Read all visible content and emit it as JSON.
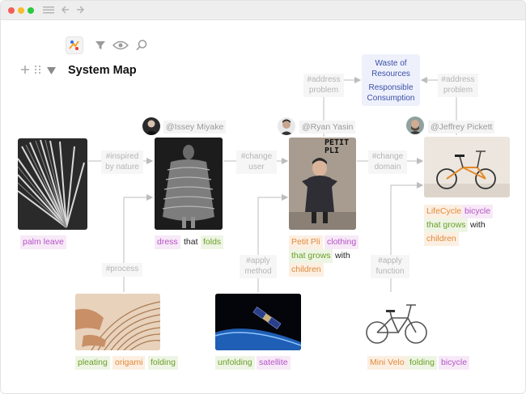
{
  "window": {
    "colors": {
      "close": "#f25f57",
      "minimize": "#f7bc2e",
      "maximize": "#2ac940"
    },
    "icons": [
      "menu-icon",
      "back-arrow-icon",
      "forward-arrow-icon"
    ]
  },
  "toolbar": {
    "icons": [
      "app-logo-icon",
      "filter-icon",
      "eye-icon",
      "search-icon"
    ]
  },
  "header": {
    "title": "System Map",
    "icons": [
      "plus-icon",
      "drag-handle-icon",
      "collapse-triangle-icon"
    ]
  },
  "relations": {
    "inspired": "#inspired\nby nature",
    "change_user": "#change\nuser",
    "change_domain": "#change\ndomain",
    "process": "#process",
    "apply_method": "#apply\nmethod",
    "apply_function": "#apply\nfunction",
    "address_left": "#address\nproblem",
    "address_right": "#address\nproblem"
  },
  "concepts": {
    "waste": "Waste of\nResources",
    "responsible": "Responsible\nConsumption"
  },
  "users": {
    "issey": "@Issey Miyake",
    "ryan": "@Ryan Yasin",
    "jeffrey": "@Jeffrey Pickett"
  },
  "photos": {
    "petit_pli_text": "PETIT\nPLI"
  },
  "tags": {
    "palm": "palm leave",
    "dress": "dress",
    "that": "that",
    "folds": "folds",
    "petit_pli": "Petit Pli",
    "clothing": "clothing",
    "that_grows_1": "that grows",
    "with_1": "with",
    "children_1": "children",
    "lifecycle": "LifeCycle",
    "bicycle_1": "bicycle",
    "that_grows_2": "that grows",
    "with_2": "with",
    "children_2": "children",
    "pleating": "pleating",
    "origami": "origami",
    "folding_1": "folding",
    "unfolding": "unfolding",
    "satellite": "satellite",
    "mini_velo": "Mini Velo",
    "folding_2": "folding",
    "bicycle_2": "bicycle"
  },
  "colors": {
    "purple_tag": "#b554c6",
    "green_tag": "#6b9f2a",
    "orange_tag": "#e08a3c",
    "concept_text": "#3c4fa8",
    "connector": "#c9c9c9"
  }
}
